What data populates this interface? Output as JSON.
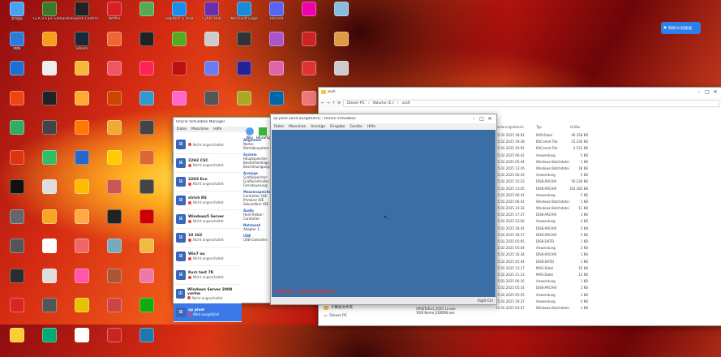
{
  "desktop_icons": [
    {
      "label": "此电脑",
      "color": "#4aa3f0"
    },
    {
      "label": "GTA V Epic Edition",
      "color": "#3c7a2a"
    },
    {
      "label": "Alienware Control",
      "color": "#222"
    },
    {
      "label": "Netflix",
      "color": "#d81f26"
    },
    {
      "label": "",
      "color": "#5a5"
    },
    {
      "label": "Logitech G HUB",
      "color": "#1c8ce6"
    },
    {
      "label": "Cyber Hub",
      "color": "#6a2ea8"
    },
    {
      "label": "Microsoft Edge",
      "color": "#1a8ad4"
    },
    {
      "label": "Discord",
      "color": "#5865f2"
    },
    {
      "label": "",
      "color": "#e0a"
    },
    {
      "label": "",
      "color": "#8bd"
    },
    {
      "label": "网络",
      "color": "#2c7ad6"
    },
    {
      "label": "",
      "color": "#f59e1b"
    },
    {
      "label": "Steam",
      "color": "#1b2838"
    },
    {
      "label": "",
      "color": "#e63"
    },
    {
      "label": "",
      "color": "#222"
    },
    {
      "label": "",
      "color": "#5a2"
    },
    {
      "label": "",
      "color": "#ccc"
    },
    {
      "label": "",
      "color": "#333"
    },
    {
      "label": "",
      "color": "#a5c"
    },
    {
      "label": "",
      "color": "#c22"
    },
    {
      "label": "",
      "color": "#d94"
    },
    {
      "label": "",
      "color": "#1f6fd1"
    },
    {
      "label": "",
      "color": "#eee"
    },
    {
      "label": "",
      "color": "#f4b83a"
    },
    {
      "label": "",
      "color": "#e56"
    },
    {
      "label": "",
      "color": "#f25"
    },
    {
      "label": "",
      "color": "#b11"
    },
    {
      "label": "",
      "color": "#6b7bf0"
    },
    {
      "label": "",
      "color": "#229"
    },
    {
      "label": "",
      "color": "#d6a"
    },
    {
      "label": "",
      "color": "#d33"
    },
    {
      "label": "",
      "color": "#ccc"
    },
    {
      "label": "",
      "color": "#e41"
    },
    {
      "label": "",
      "color": "#222"
    },
    {
      "label": "",
      "color": "#fa3"
    },
    {
      "label": "",
      "color": "#c40"
    },
    {
      "label": "",
      "color": "#39c"
    },
    {
      "label": "",
      "color": "#f6c"
    },
    {
      "label": "",
      "color": "#555"
    },
    {
      "label": "",
      "color": "#aa2"
    },
    {
      "label": "",
      "color": "#06a"
    },
    {
      "label": "",
      "color": "#e77"
    },
    {
      "label": "",
      "color": "#3a6"
    },
    {
      "label": "",
      "color": "#444"
    },
    {
      "label": "",
      "color": "#f70"
    },
    {
      "label": "",
      "color": "#ea3"
    },
    {
      "label": "",
      "color": "#444"
    },
    {
      "label": "",
      "color": "#c33"
    },
    {
      "label": "",
      "color": "#2a2"
    },
    {
      "label": "",
      "color": "#b52"
    },
    {
      "label": "",
      "color": "#d31"
    },
    {
      "label": "",
      "color": "#3b6"
    },
    {
      "label": "",
      "color": "#2a66c8"
    },
    {
      "label": "",
      "color": "#fc0"
    },
    {
      "label": "",
      "color": "#d63"
    },
    {
      "label": "",
      "color": "#555"
    },
    {
      "label": "",
      "color": "#111"
    },
    {
      "label": "",
      "color": "#ddd"
    },
    {
      "label": "",
      "color": "#fb0"
    },
    {
      "label": "",
      "color": "#c55"
    },
    {
      "label": "",
      "color": "#444"
    },
    {
      "label": "",
      "color": "#666"
    },
    {
      "label": "",
      "color": "#f5a623"
    },
    {
      "label": "",
      "color": "#fa4"
    },
    {
      "label": "",
      "color": "#222"
    },
    {
      "label": "",
      "color": "#c00"
    },
    {
      "label": "",
      "color": "#555"
    },
    {
      "label": "",
      "color": "#fff"
    },
    {
      "label": "",
      "color": "#e66"
    },
    {
      "label": "",
      "color": "#7ab"
    },
    {
      "label": "",
      "color": "#eb4"
    },
    {
      "label": "",
      "color": "#2c2c2c"
    },
    {
      "label": "",
      "color": "#ddd"
    },
    {
      "label": "",
      "color": "#f5a"
    },
    {
      "label": "",
      "color": "#a53"
    },
    {
      "label": "",
      "color": "#e7a"
    },
    {
      "label": "",
      "color": "#d22"
    },
    {
      "label": "",
      "color": "#555"
    },
    {
      "label": "",
      "color": "#e6c200"
    },
    {
      "label": "",
      "color": "#c44"
    },
    {
      "label": "",
      "color": "#1a1"
    },
    {
      "label": "",
      "color": "#fc3"
    },
    {
      "label": "",
      "color": "#0a7"
    },
    {
      "label": "",
      "color": "#fff"
    },
    {
      "label": "",
      "color": "#c22"
    },
    {
      "label": "",
      "color": "#27a"
    }
  ],
  "toast": {
    "text": "网易UU加速器"
  },
  "vbox": {
    "title": "Oracle VirtualBox Manager",
    "menu": [
      "Datei",
      "Maschine",
      "Hilfe"
    ],
    "tool_new": "Neu",
    "tool_add": "Hinzufügen",
    "vms": [
      {
        "name": "",
        "state": "Nicht angeschaltet"
      },
      {
        "name": "22H2 CSC",
        "state": "Nicht angeschaltet"
      },
      {
        "name": "22H2 Eco",
        "state": "Nicht angeschaltet"
      },
      {
        "name": "strich RS",
        "state": "Nicht angeschaltet"
      },
      {
        "name": "Windows5 Server",
        "state": "Nicht angeschaltet"
      },
      {
        "name": "10 162",
        "state": "Nicht angeschaltet"
      },
      {
        "name": "Win7 oo",
        "state": "Nicht angeschaltet"
      },
      {
        "name": "Kurz test 7K",
        "state": "Nicht angeschaltet"
      },
      {
        "name": "Windows Server 2008 vorlne",
        "state": "Nicht angeschaltet"
      },
      {
        "name": "xp pixel",
        "state": "Wird ausgeführt"
      }
    ],
    "details": [
      {
        "h": "Allgemein"
      },
      {
        "t": "Name:"
      },
      {
        "t": "Betriebssystem:"
      },
      {
        "h": "System"
      },
      {
        "t": "Hauptspeicher:"
      },
      {
        "t": "Bootreihenfolge:"
      },
      {
        "t": "Beschleunigung:"
      },
      {
        "h": "Anzeige"
      },
      {
        "t": "Grafikspeicher:"
      },
      {
        "t": "Grafikcontroller:"
      },
      {
        "t": "Fernsteuerung:"
      },
      {
        "h": "Massenspeicher"
      },
      {
        "t": "Controller: IDE"
      },
      {
        "t": "Primärer IDE"
      },
      {
        "t": "Sekundärer IDE"
      },
      {
        "h": "Audio"
      },
      {
        "t": "Host-Treiber:"
      },
      {
        "t": "Controller:"
      },
      {
        "h": "Netzwerk"
      },
      {
        "t": "Adapter 1:"
      },
      {
        "h": "USB"
      },
      {
        "t": "USB-Controller:"
      }
    ]
  },
  "vmwin": {
    "title": "xp pixel [wird ausgeführt] - Oracle VirtualBox",
    "menu": [
      "Datei",
      "Maschine",
      "Anzeige",
      "Eingabe",
      "Geräte",
      "Hilfe"
    ],
    "message": "计算机错误，启动修复功能后重启...",
    "status": "Right Ctrl"
  },
  "explorer": {
    "tab": "xssh",
    "crumbs": [
      "Dieser PC",
      "Volume (E:)",
      "xssh"
    ],
    "col_date": "Änderungsdatum",
    "col_type": "Typ",
    "col_size": "Größe",
    "rows": [
      {
        "date": "25.02.2025 18:01",
        "type": "RAR-Datei",
        "size": "40.358 KB"
      },
      {
        "date": "25.02.2025 19:28",
        "type": "BitComet File",
        "size": "25.330 KB"
      },
      {
        "date": "25.02.2025 20:02",
        "type": "BitComet File",
        "size": "2.531 KB"
      },
      {
        "date": "25.02.2025 06:42",
        "type": "Anwendung",
        "size": "5 KB"
      },
      {
        "date": "25.02.2025 05:44",
        "type": "Windows Batchdatei",
        "size": "1 KB"
      },
      {
        "date": "25.02.2025 13:16",
        "type": "Windows Batchdatei",
        "size": "18 KB"
      },
      {
        "date": "25.02.2025 06:43",
        "type": "Anwendung",
        "size": "5 KB"
      },
      {
        "date": "25.02.2025 15:23",
        "type": "DISK-ARCHIV",
        "size": "56.234 KB"
      },
      {
        "date": "25.02.2025 13:05",
        "type": "DISK-ARCHIV",
        "size": "102.282 KB"
      },
      {
        "date": "25.02.2025 06:41",
        "type": "Anwendung",
        "size": "5 KB"
      },
      {
        "date": "25.02.2025 06:41",
        "type": "Windows Batchdatei",
        "size": "1 KB"
      },
      {
        "date": "25.02.2025 14:32",
        "type": "Windows Batchdatei",
        "size": "11 KB"
      },
      {
        "date": "25.02.2025 17:27",
        "type": "DISK-ARCHIV",
        "size": "1 KB"
      },
      {
        "date": "25.02.2025 23:00",
        "type": "Anwendung",
        "size": "4 KB"
      },
      {
        "date": "25.02.2025 18:42",
        "type": "DISK-ARCHIV",
        "size": "3 KB"
      },
      {
        "date": "25.02.2025 18:57",
        "type": "DISK-ARCHIV",
        "size": "5 KB"
      },
      {
        "date": "25.02.2025 05:05",
        "type": "DISK-DATEI",
        "size": "1 KB"
      },
      {
        "date": "25.02.2025 05:04",
        "type": "Anwendung",
        "size": "2 KB"
      },
      {
        "date": "25.02.2025 16:34",
        "type": "DISK-ARCHIV",
        "size": "1 KB"
      },
      {
        "date": "25.02.2025 05:44",
        "type": "DISK-DATEI",
        "size": "1 KB"
      },
      {
        "date": "25.02.2025 13:17",
        "type": "MHS-Datei",
        "size": "25 KB"
      },
      {
        "date": "25.02.2025 21:23",
        "type": "MHS-Datei",
        "size": "12 KB"
      },
      {
        "date": "25.02.2025 06:16",
        "type": "Anwendung",
        "size": "1 KB"
      },
      {
        "date": "25.02.2025 05:14",
        "type": "DISK-ARCHIV",
        "size": "1 KB"
      },
      {
        "date": "25.02.2025 05:55",
        "type": "Anwendung",
        "size": "1 KB"
      },
      {
        "date": "25.02.2025 19:27",
        "type": "Anwendung",
        "size": "4 KB"
      },
      {
        "date": "25.02.2025 04:57",
        "type": "Windows Batchdatei",
        "size": "1 KB"
      }
    ],
    "nav": [
      "计算机文件夹",
      "Dieser PC"
    ],
    "left_files": [
      "XPSETuEsd_2020 1a.exe",
      "YDifi Nvme_EDIDPB.exe"
    ]
  }
}
